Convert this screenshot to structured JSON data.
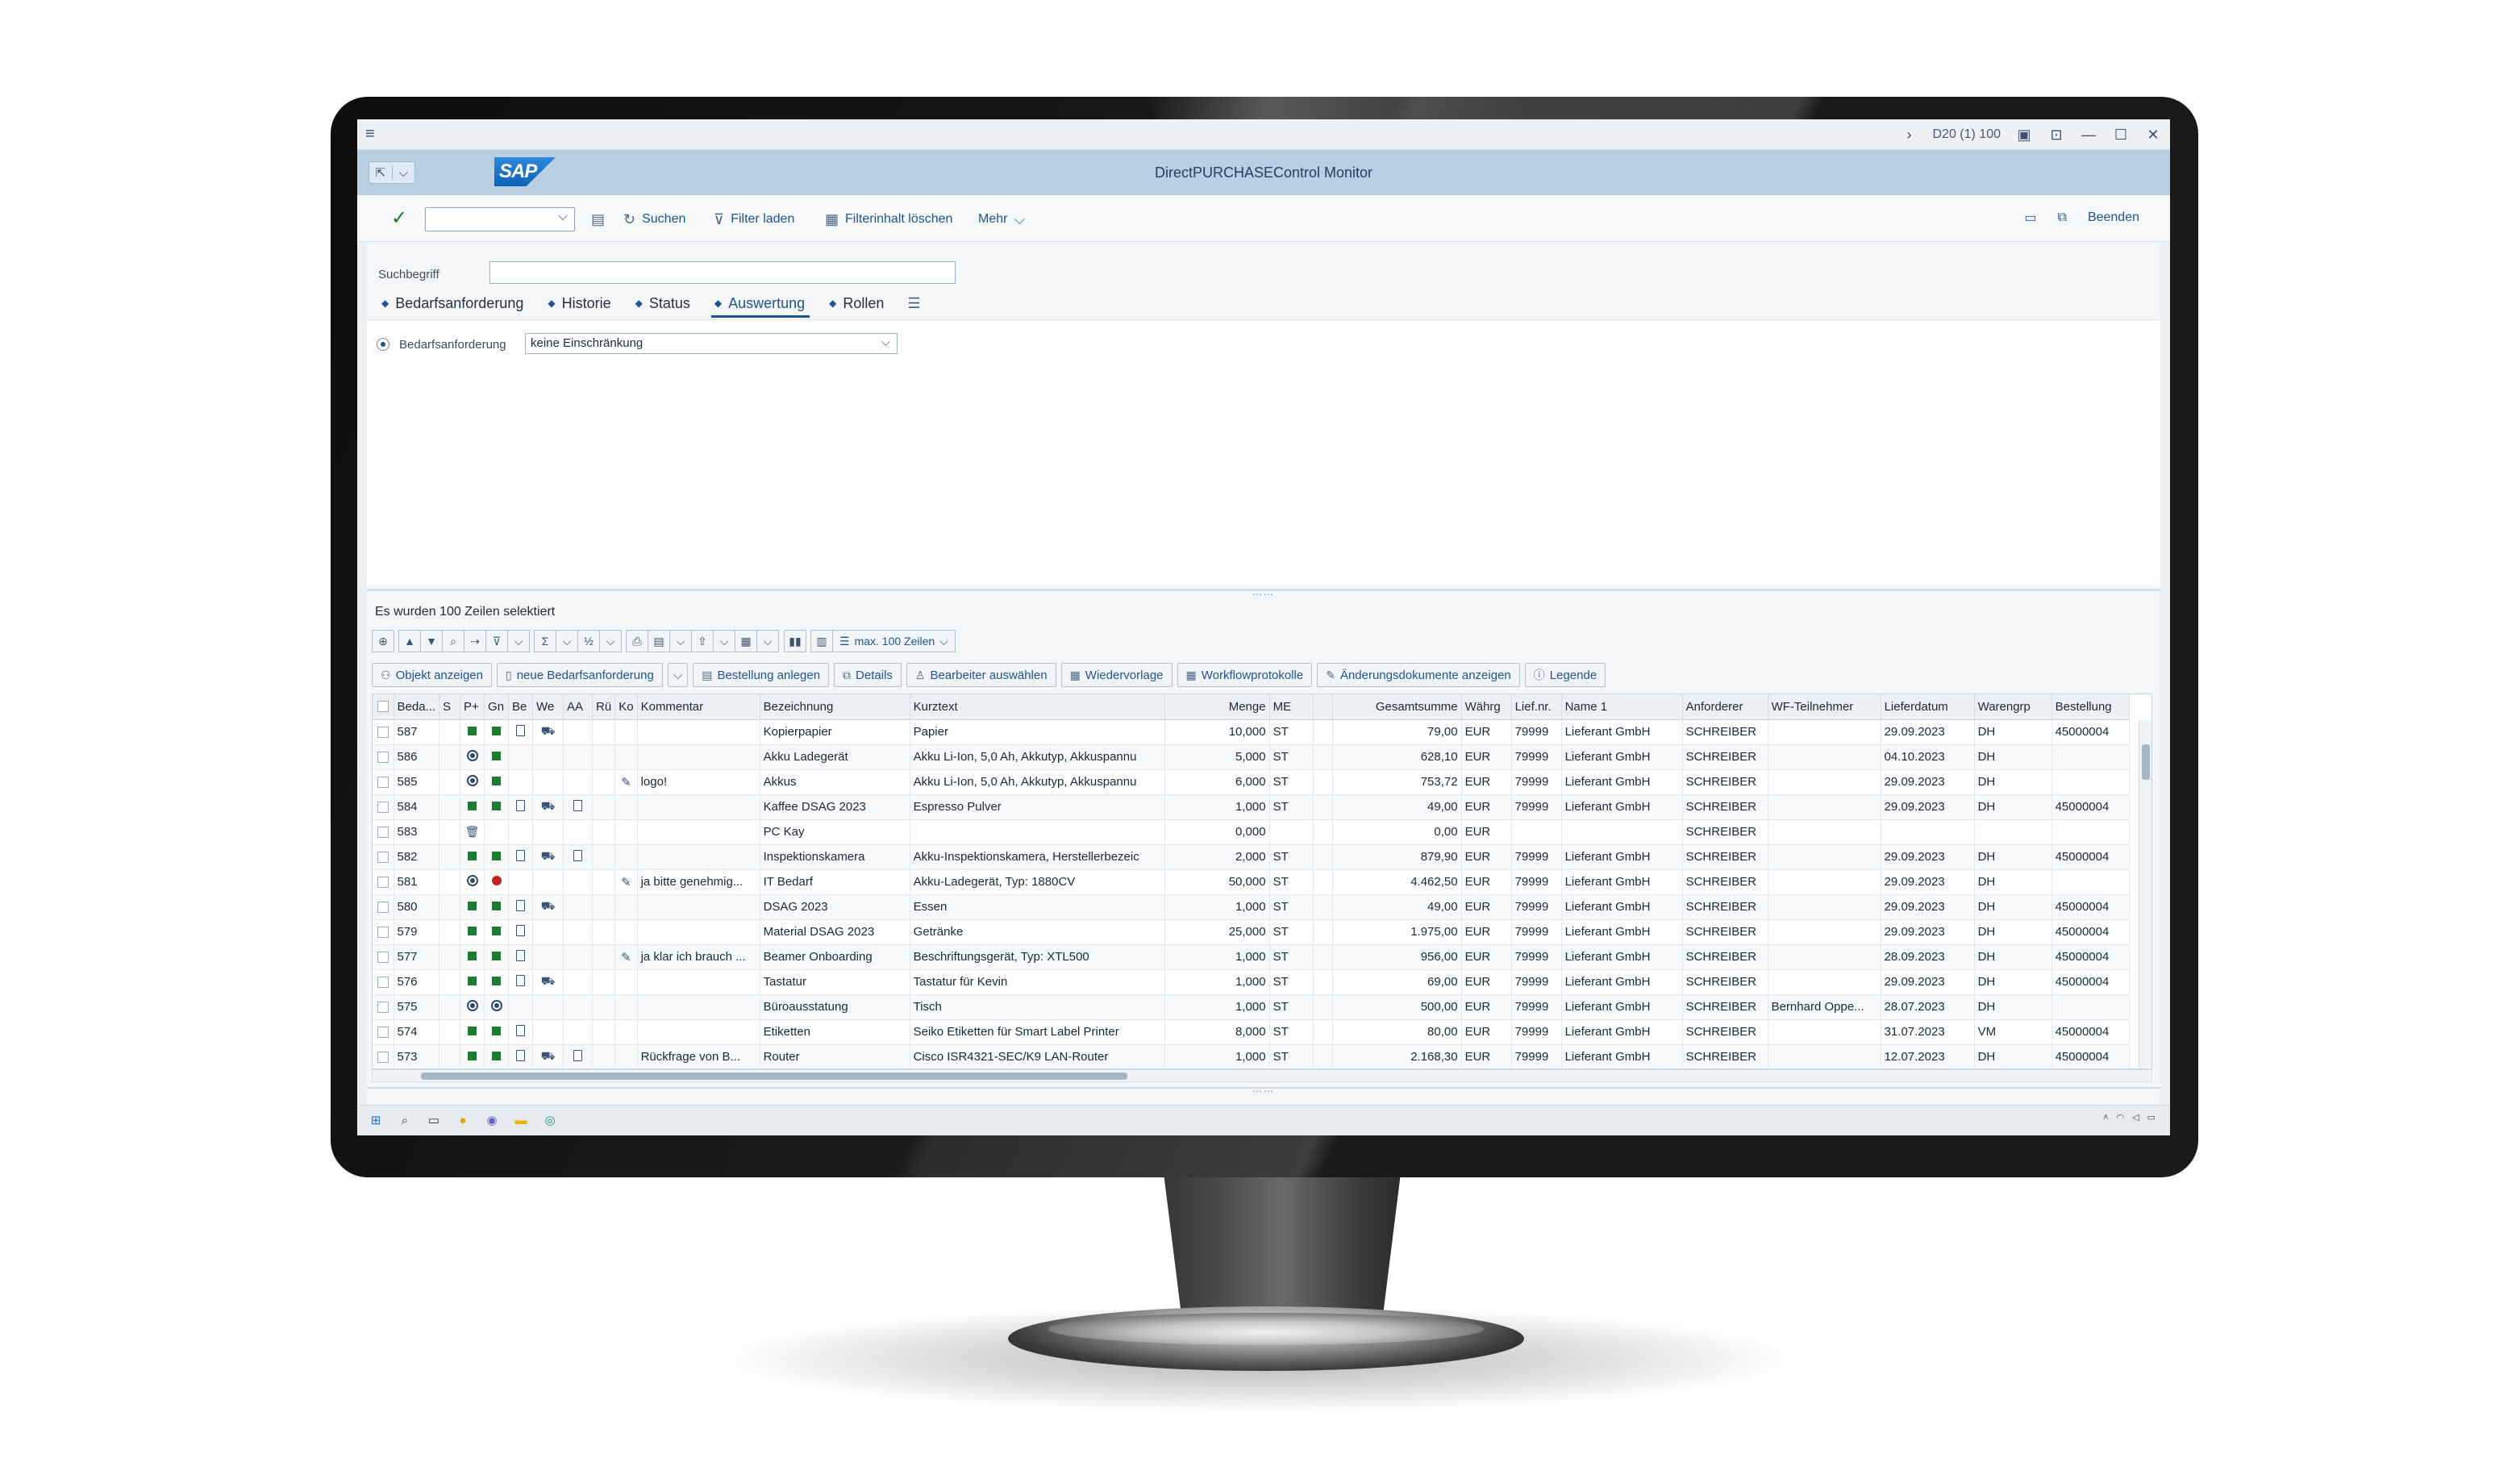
{
  "window": {
    "system_label": "D20 (1) 100",
    "app_title": "DirectPURCHASEControl Monitor",
    "logo_text": "SAP"
  },
  "toolbar": {
    "search_label": "Suchen",
    "filter_load_label": "Filter laden",
    "filter_clear_label": "Filterinhalt löschen",
    "more_label": "Mehr",
    "exit_label": "Beenden"
  },
  "search": {
    "label": "Suchbegriff",
    "value": ""
  },
  "tabs": [
    {
      "label": "Bedarfsanforderung"
    },
    {
      "label": "Historie"
    },
    {
      "label": "Status"
    },
    {
      "label": "Auswertung"
    },
    {
      "label": "Rollen"
    }
  ],
  "filter": {
    "label": "Bedarfsanforderung",
    "value": "keine Einschränkung"
  },
  "result": {
    "status": "Es wurden 100 Zeilen selektiert",
    "max_rows_label": "max. 100 Zeilen"
  },
  "actions": [
    {
      "label": "Objekt anzeigen",
      "icon": "glasses-icon"
    },
    {
      "label": "neue Bedarfsanforderung",
      "icon": "document-icon"
    },
    {
      "label": "Bestellung anlegen",
      "icon": "order-icon"
    },
    {
      "label": "Details",
      "icon": "details-icon"
    },
    {
      "label": "Bearbeiter auswählen",
      "icon": "user-icon"
    },
    {
      "label": "Wiedervorlage",
      "icon": "calendar-icon"
    },
    {
      "label": "Workflowprotokolle",
      "icon": "log-icon"
    },
    {
      "label": "Änderungsdokumente anzeigen",
      "icon": "change-doc-icon"
    },
    {
      "label": "Legende",
      "icon": "legend-icon"
    }
  ],
  "columns": [
    "Beda...",
    "S",
    "P+",
    "Gn",
    "Be",
    "We",
    "AA",
    "Rü",
    "Ko",
    "Kommentar",
    "Bezeichnung",
    "Kurztext",
    "Menge",
    "ME",
    "",
    "Gesamtsumme",
    "Währg",
    "Lief.nr.",
    "Name 1",
    "Anforderer",
    "WF-Teilnehmer",
    "Lieferdatum",
    "Warengrp",
    "Bestellung"
  ],
  "rows": [
    {
      "nr": "587",
      "p": "green",
      "gn": "green",
      "be": "doc",
      "we": "car",
      "aa": "",
      "kom": "",
      "kpen": false,
      "bez": "Kopierpapier",
      "kurz": "Papier",
      "menge": "10,000",
      "me": "ST",
      "summe": "79,00",
      "waehr": "EUR",
      "lief": "79999",
      "name": "Lieferant GmbH",
      "anf": "SCHREIBER",
      "wf": "",
      "datum": "29.09.2023",
      "wg": "DH",
      "best": "45000004"
    },
    {
      "nr": "586",
      "p": "globe",
      "gn": "green",
      "be": "",
      "we": "",
      "aa": "",
      "kom": "",
      "kpen": false,
      "bez": "Akku Ladegerät",
      "kurz": "Akku Li-Ion, 5,0 Ah, Akkutyp, Akkuspannu",
      "menge": "5,000",
      "me": "ST",
      "summe": "628,10",
      "waehr": "EUR",
      "lief": "79999",
      "name": "Lieferant GmbH",
      "anf": "SCHREIBER",
      "wf": "",
      "datum": "04.10.2023",
      "wg": "DH",
      "best": ""
    },
    {
      "nr": "585",
      "p": "globe",
      "gn": "green",
      "be": "",
      "we": "",
      "aa": "",
      "kom": "logo!",
      "kpen": true,
      "bez": "Akkus",
      "kurz": "Akku Li-Ion, 5,0 Ah, Akkutyp, Akkuspannu",
      "menge": "6,000",
      "me": "ST",
      "summe": "753,72",
      "waehr": "EUR",
      "lief": "79999",
      "name": "Lieferant GmbH",
      "anf": "SCHREIBER",
      "wf": "",
      "datum": "29.09.2023",
      "wg": "DH",
      "best": ""
    },
    {
      "nr": "584",
      "p": "green",
      "gn": "green",
      "be": "doc",
      "we": "car",
      "aa": "doc",
      "kom": "",
      "kpen": false,
      "bez": "Kaffee DSAG 2023",
      "kurz": "Espresso Pulver",
      "menge": "1,000",
      "me": "ST",
      "summe": "49,00",
      "waehr": "EUR",
      "lief": "79999",
      "name": "Lieferant GmbH",
      "anf": "SCHREIBER",
      "wf": "",
      "datum": "29.09.2023",
      "wg": "DH",
      "best": "45000004"
    },
    {
      "nr": "583",
      "p": "trash",
      "gn": "",
      "be": "",
      "we": "",
      "aa": "",
      "kom": "",
      "kpen": false,
      "bez": "PC Kay",
      "kurz": "",
      "menge": "0,000",
      "me": "",
      "summe": "0,00",
      "waehr": "EUR",
      "lief": "",
      "name": "",
      "anf": "SCHREIBER",
      "wf": "",
      "datum": "",
      "wg": "",
      "best": ""
    },
    {
      "nr": "582",
      "p": "green",
      "gn": "green",
      "be": "doc",
      "we": "car",
      "aa": "doc",
      "kom": "",
      "kpen": false,
      "bez": "Inspektionskamera",
      "kurz": "Akku-Inspektionskamera, Herstellerbezeic",
      "menge": "2,000",
      "me": "ST",
      "summe": "879,90",
      "waehr": "EUR",
      "lief": "79999",
      "name": "Lieferant GmbH",
      "anf": "SCHREIBER",
      "wf": "",
      "datum": "29.09.2023",
      "wg": "DH",
      "best": "45000004"
    },
    {
      "nr": "581",
      "p": "globe",
      "gn": "red",
      "be": "",
      "we": "",
      "aa": "",
      "kom": "ja bitte genehmig...",
      "kpen": true,
      "bez": "IT Bedarf",
      "kurz": "Akku-Ladegerät, Typ: 1880CV",
      "menge": "50,000",
      "me": "ST",
      "summe": "4.462,50",
      "waehr": "EUR",
      "lief": "79999",
      "name": "Lieferant GmbH",
      "anf": "SCHREIBER",
      "wf": "",
      "datum": "29.09.2023",
      "wg": "DH",
      "best": ""
    },
    {
      "nr": "580",
      "p": "green",
      "gn": "green",
      "be": "doc",
      "we": "car",
      "aa": "",
      "kom": "",
      "kpen": false,
      "bez": "DSAG 2023",
      "kurz": "Essen",
      "menge": "1,000",
      "me": "ST",
      "summe": "49,00",
      "waehr": "EUR",
      "lief": "79999",
      "name": "Lieferant GmbH",
      "anf": "SCHREIBER",
      "wf": "",
      "datum": "29.09.2023",
      "wg": "DH",
      "best": "45000004"
    },
    {
      "nr": "579",
      "p": "green",
      "gn": "green",
      "be": "doc",
      "we": "",
      "aa": "",
      "kom": "",
      "kpen": false,
      "bez": "Material DSAG 2023",
      "kurz": "Getränke",
      "menge": "25,000",
      "me": "ST",
      "summe": "1.975,00",
      "waehr": "EUR",
      "lief": "79999",
      "name": "Lieferant GmbH",
      "anf": "SCHREIBER",
      "wf": "",
      "datum": "29.09.2023",
      "wg": "DH",
      "best": "45000004"
    },
    {
      "nr": "577",
      "p": "green",
      "gn": "green",
      "be": "doc",
      "we": "",
      "aa": "",
      "kom": "ja klar ich brauch ...",
      "kpen": true,
      "bez": "Beamer Onboarding",
      "kurz": "Beschriftungsgerät, Typ: XTL500",
      "menge": "1,000",
      "me": "ST",
      "summe": "956,00",
      "waehr": "EUR",
      "lief": "79999",
      "name": "Lieferant GmbH",
      "anf": "SCHREIBER",
      "wf": "",
      "datum": "28.09.2023",
      "wg": "DH",
      "best": "45000004"
    },
    {
      "nr": "576",
      "p": "green",
      "gn": "green",
      "be": "doc",
      "we": "car",
      "aa": "",
      "kom": "",
      "kpen": false,
      "bez": "Tastatur",
      "kurz": "Tastatur für Kevin",
      "menge": "1,000",
      "me": "ST",
      "summe": "69,00",
      "waehr": "EUR",
      "lief": "79999",
      "name": "Lieferant GmbH",
      "anf": "SCHREIBER",
      "wf": "",
      "datum": "29.09.2023",
      "wg": "DH",
      "best": "45000004"
    },
    {
      "nr": "575",
      "p": "globe",
      "gn": "globe",
      "be": "",
      "we": "",
      "aa": "",
      "kom": "",
      "kpen": false,
      "bez": "Büroausstatung",
      "kurz": "Tisch",
      "menge": "1,000",
      "me": "ST",
      "summe": "500,00",
      "waehr": "EUR",
      "lief": "79999",
      "name": "Lieferant GmbH",
      "anf": "SCHREIBER",
      "wf": "Bernhard Oppe...",
      "datum": "28.07.2023",
      "wg": "DH",
      "best": ""
    },
    {
      "nr": "574",
      "p": "green",
      "gn": "green",
      "be": "doc",
      "we": "",
      "aa": "",
      "kom": "",
      "kpen": false,
      "bez": "Etiketten",
      "kurz": "Seiko Etiketten für Smart Label Printer",
      "menge": "8,000",
      "me": "ST",
      "summe": "80,00",
      "waehr": "EUR",
      "lief": "79999",
      "name": "Lieferant GmbH",
      "anf": "SCHREIBER",
      "wf": "",
      "datum": "31.07.2023",
      "wg": "VM",
      "best": "45000004"
    },
    {
      "nr": "573",
      "p": "green",
      "gn": "green",
      "be": "doc",
      "we": "car",
      "aa": "doc",
      "kom": "Rückfrage von B...",
      "kpen": false,
      "bez": "Router",
      "kurz": "Cisco ISR4321-SEC/K9 LAN-Router",
      "menge": "1,000",
      "me": "ST",
      "summe": "2.168,30",
      "waehr": "EUR",
      "lief": "79999",
      "name": "Lieferant GmbH",
      "anf": "SCHREIBER",
      "wf": "",
      "datum": "12.07.2023",
      "wg": "DH",
      "best": "45000004"
    }
  ],
  "colors": {
    "header_blue": "#b8cfe4",
    "link_blue": "#1e5590",
    "status_green": "#1f7a34",
    "status_red": "#c0221a"
  }
}
